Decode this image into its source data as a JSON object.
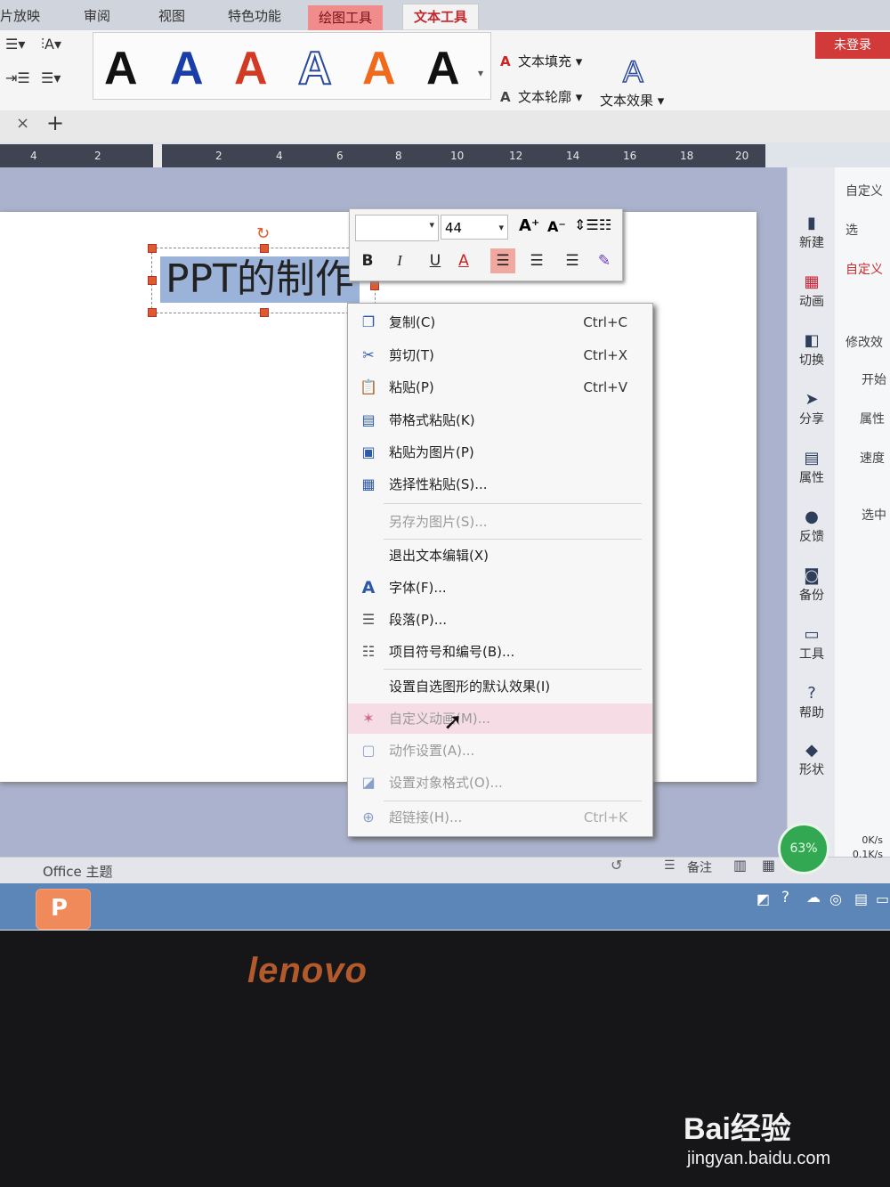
{
  "ribbon": {
    "tabs": [
      "片放映",
      "审阅",
      "视图",
      "特色功能",
      "绘图工具",
      "文本工具"
    ],
    "active_tab": "文本工具",
    "login_label": "未登录",
    "text_style_letter": "A",
    "text_fill_label": "文本填充 ▾",
    "text_outline_label": "文本轮廓 ▾",
    "text_effect_label": "文本效果 ▾"
  },
  "docstrip": {
    "close": "×",
    "add": "+"
  },
  "ruler": {
    "ticks": [
      "4",
      "2",
      "2",
      "4",
      "6",
      "8",
      "10",
      "12",
      "14",
      "16",
      "18",
      "20"
    ]
  },
  "slide": {
    "title": "PPT的制作"
  },
  "mini_toolbar": {
    "font_size": "44",
    "bold": "B",
    "italic": "I",
    "underline": "U",
    "font_color": "A"
  },
  "context_menu": {
    "items": [
      {
        "label": "复制(C)",
        "shortcut": "Ctrl+C",
        "icon": "copy-icon"
      },
      {
        "label": "剪切(T)",
        "shortcut": "Ctrl+X",
        "icon": "scissors-icon"
      },
      {
        "label": "粘贴(P)",
        "shortcut": "Ctrl+V",
        "icon": "paste-icon"
      },
      {
        "label": "带格式粘贴(K)",
        "shortcut": "",
        "icon": "paste-format-icon"
      },
      {
        "label": "粘贴为图片(P)",
        "shortcut": "",
        "icon": "paste-image-icon"
      },
      {
        "label": "选择性粘贴(S)...",
        "shortcut": "",
        "icon": "paste-special-icon"
      },
      {
        "label": "另存为图片(S)...",
        "shortcut": "",
        "icon": "",
        "disabled": true
      },
      {
        "label": "退出文本编辑(X)",
        "shortcut": "",
        "icon": ""
      },
      {
        "label": "字体(F)...",
        "shortcut": "",
        "icon": "font-icon"
      },
      {
        "label": "段落(P)...",
        "shortcut": "",
        "icon": "paragraph-icon"
      },
      {
        "label": "项目符号和编号(B)...",
        "shortcut": "",
        "icon": "bullets-icon"
      },
      {
        "label": "设置自选图形的默认效果(I)",
        "shortcut": "",
        "icon": ""
      },
      {
        "label": "自定义动画(M)...",
        "shortcut": "",
        "icon": "animation-icon",
        "disabled": true
      },
      {
        "label": "动作设置(A)...",
        "shortcut": "",
        "icon": "action-icon",
        "disabled": true
      },
      {
        "label": "设置对象格式(O)...",
        "shortcut": "",
        "icon": "format-object-icon",
        "disabled": true
      },
      {
        "label": "超链接(H)...",
        "shortcut": "Ctrl+K",
        "icon": "hyperlink-icon",
        "disabled": true
      }
    ]
  },
  "right_sidebar": {
    "items": [
      "新建",
      "动画",
      "切换",
      "分享",
      "属性",
      "反馈",
      "备份",
      "工具",
      "帮助",
      "形状"
    ]
  },
  "right_panel": {
    "items": [
      "自定义",
      "选",
      "自定义",
      "修改效",
      "开始",
      "属性",
      "速度",
      "选中"
    ]
  },
  "status_bar": {
    "theme": "Office 主题",
    "notes": "备注",
    "gauge": "63%",
    "net_up": "0K/s",
    "net_down": "0.1K/s"
  },
  "taskbar": {
    "app_letter": "P"
  },
  "bezel": {
    "brand": "lenovo",
    "watermark": "Bai经验",
    "watermark_url": "jingyan.baidu.com"
  }
}
